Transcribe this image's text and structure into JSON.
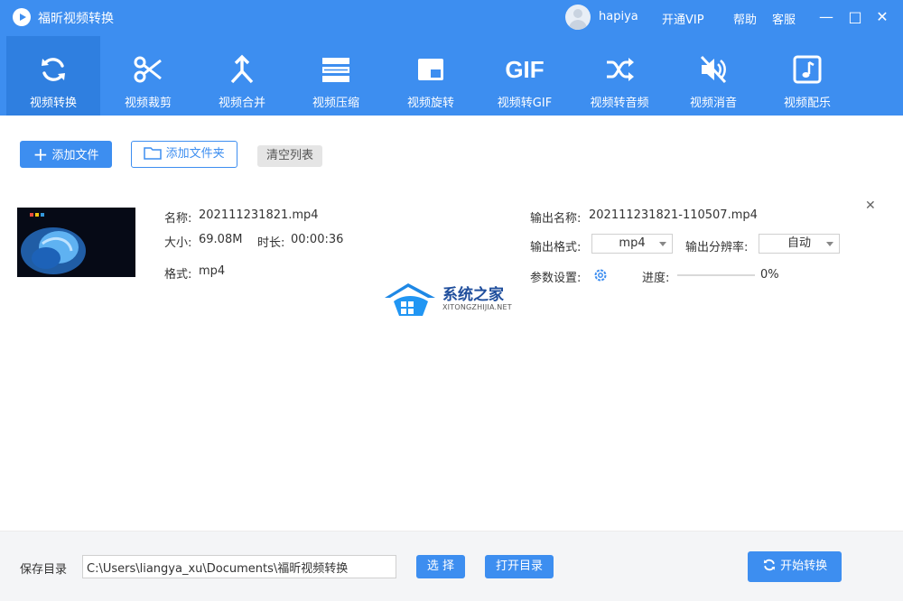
{
  "window": {
    "title": "福昕视频转换",
    "username": "hapiya",
    "links": [
      "开通VIP",
      "帮助",
      "客服"
    ],
    "controls": [
      "—",
      "□",
      "✕"
    ]
  },
  "toolbar": {
    "items": [
      {
        "label": "视频转换",
        "icon": "convert-icon",
        "active": true
      },
      {
        "label": "视频裁剪",
        "icon": "scissors-icon",
        "active": false
      },
      {
        "label": "视频合并",
        "icon": "merge-icon",
        "active": false
      },
      {
        "label": "视频压缩",
        "icon": "compress-icon",
        "active": false
      },
      {
        "label": "视频旋转",
        "icon": "rotate-icon",
        "active": false
      },
      {
        "label": "视频转GIF",
        "icon": "gif-icon",
        "active": false
      },
      {
        "label": "视频转音频",
        "icon": "shuffle-icon",
        "active": false
      },
      {
        "label": "视频消音",
        "icon": "mute-icon",
        "active": false
      },
      {
        "label": "视频配乐",
        "icon": "music-icon",
        "active": false
      }
    ],
    "gif_glyph": "GIF"
  },
  "actions": {
    "add_file": "添加文件",
    "add_folder": "添加文件夹",
    "clear_list": "清空列表"
  },
  "file": {
    "name_label": "名称:",
    "name": "202111231821.mp4",
    "size_label": "大小:",
    "size": "69.08M",
    "duration_label": "时长:",
    "duration": "00:00:36",
    "format_label": "格式:",
    "format": "mp4",
    "output_name_label": "输出名称:",
    "output_name": "202111231821-110507.mp4",
    "output_format_label": "输出格式:",
    "output_format": "mp4",
    "output_resolution_label": "输出分辨率:",
    "output_resolution": "自动",
    "params_label": "参数设置:",
    "progress_label": "进度:",
    "progress_text": "0%",
    "progress_value": 0
  },
  "watermark": {
    "text": "系统之家",
    "sub": "XITONGZHIJIA.NET"
  },
  "bottom": {
    "save_dir_label": "保存目录",
    "save_dir": "C:\\Users\\liangya_xu\\Documents\\福昕视频转换",
    "choose": "选 择",
    "open_dir": "打开目录",
    "start": "开始转换"
  },
  "colors": {
    "accent": "#3d8ef0",
    "accent_dark": "#2f7fe0"
  }
}
